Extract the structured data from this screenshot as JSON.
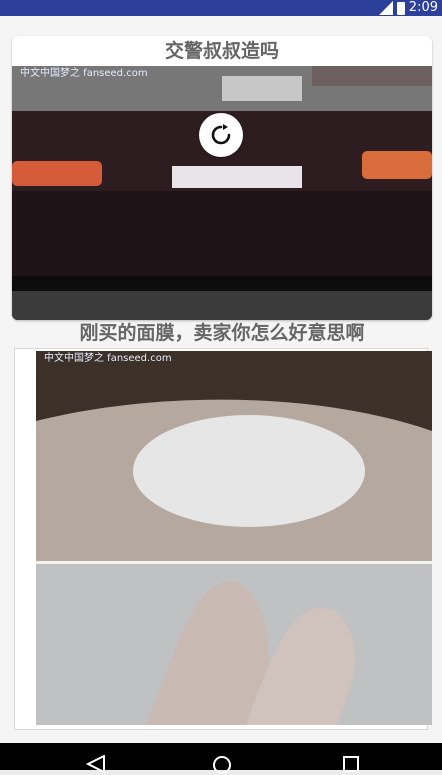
{
  "status": {
    "time": "2:09"
  },
  "feed": {
    "items": [
      {
        "title": "交警叔叔造吗",
        "watermark": "中文中国梦之 fanseed.com"
      },
      {
        "title": "刚买的面膜，卖家你怎么好意思啊",
        "watermark": "中文中国梦之 fanseed.com"
      }
    ]
  },
  "icons": {
    "play": "replay-icon",
    "back": "back-icon",
    "home": "home-icon",
    "recents": "recents-icon"
  }
}
